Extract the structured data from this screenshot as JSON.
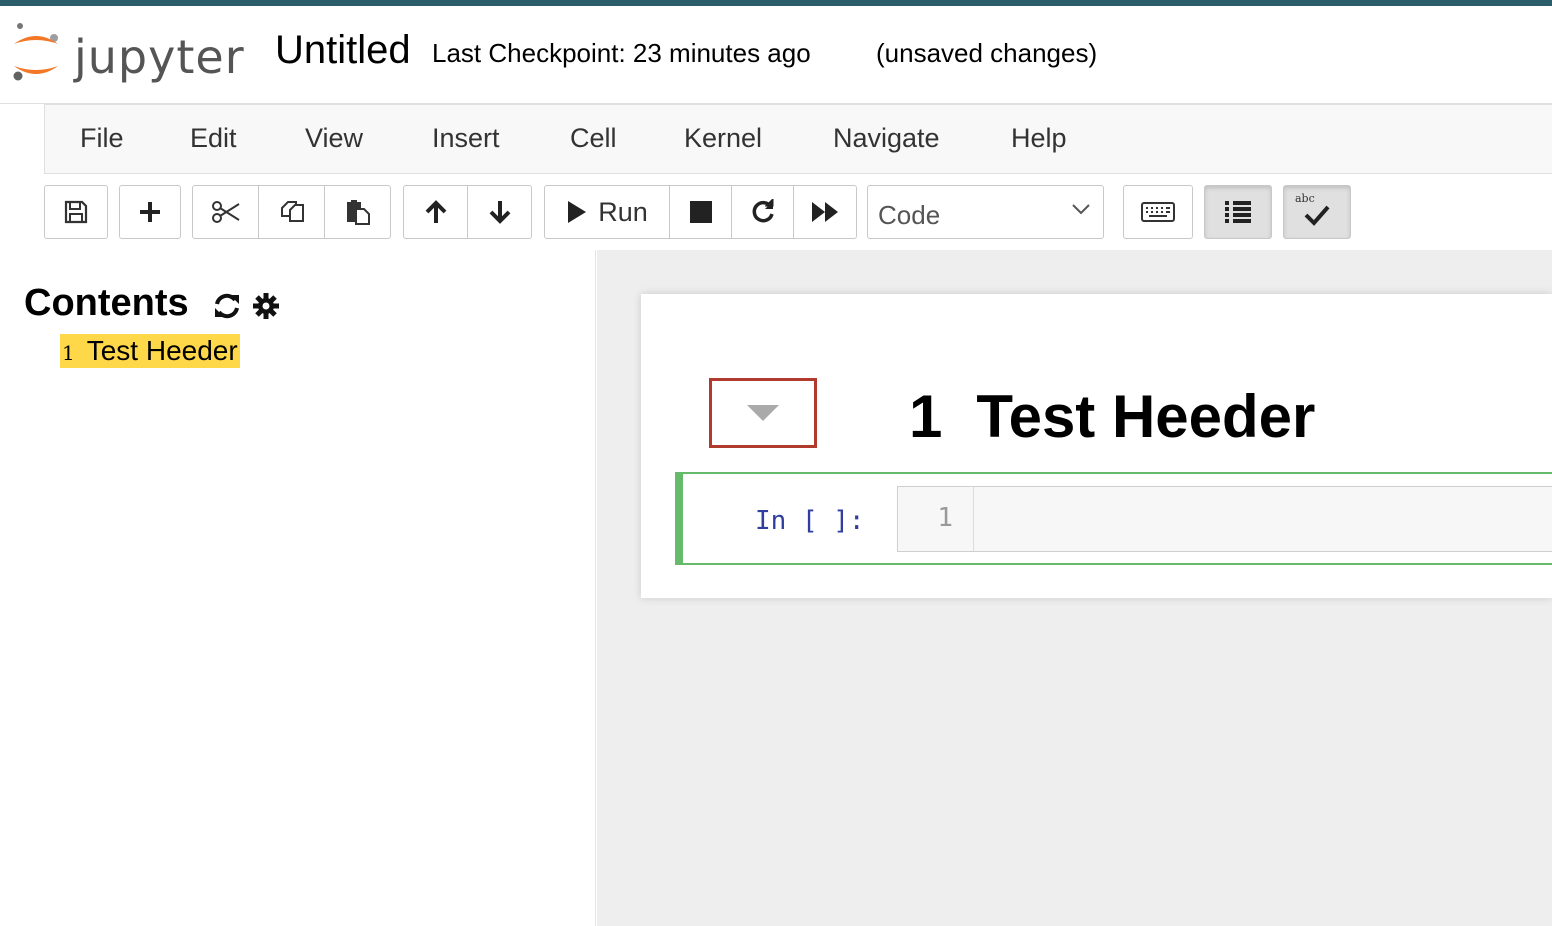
{
  "header": {
    "logo_text": "jupyter",
    "notebook_title": "Untitled",
    "checkpoint": "Last Checkpoint: 23 minutes ago",
    "status": "(unsaved changes)"
  },
  "menu": {
    "items": [
      "File",
      "Edit",
      "View",
      "Insert",
      "Cell",
      "Kernel",
      "Navigate",
      "Help"
    ]
  },
  "toolbar": {
    "run_label": "Run",
    "cell_type": "Code",
    "icons": [
      "save-icon",
      "plus-icon",
      "cut-icon",
      "copy-icon",
      "paste-icon",
      "arrow-up-icon",
      "arrow-down-icon",
      "play-icon",
      "stop-icon",
      "restart-icon",
      "fast-forward-icon",
      "keyboard-icon",
      "list-icon",
      "spellcheck-icon"
    ],
    "spellcheck_label": "abc"
  },
  "toc": {
    "title": "Contents",
    "items": [
      {
        "number": "1",
        "label": "Test Heeder"
      }
    ]
  },
  "notebook": {
    "heading_number": "1",
    "heading_text": "Test Heeder",
    "cell_prompt": "In [ ]:",
    "line_number": "1"
  },
  "colors": {
    "accent_bar": "#2c5d6b",
    "toc_highlight": "#ffd84a",
    "selected_cell": "#66bb6a",
    "annotation_box": "#b03a2e",
    "prompt": "#303f9f"
  }
}
